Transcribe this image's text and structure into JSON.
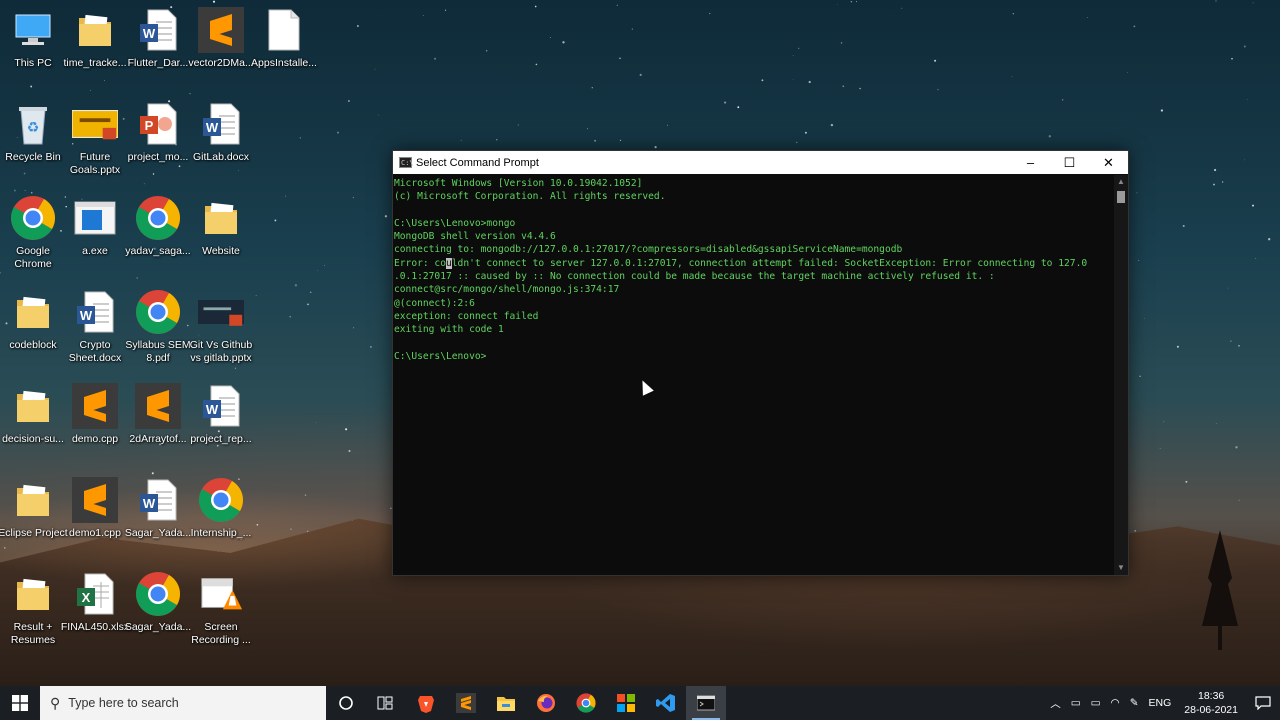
{
  "desktop_icons": [
    {
      "label": "This PC",
      "icon": "this-pc-icon"
    },
    {
      "label": "time_tracke...",
      "icon": "folder-icon"
    },
    {
      "label": "Flutter_Dar...",
      "icon": "word-doc-icon"
    },
    {
      "label": "vector2DMa...",
      "icon": "sublime-icon"
    },
    {
      "label": "AppsInstalle...",
      "icon": "text-file-icon"
    },
    {
      "label": "Recycle Bin",
      "icon": "recycle-bin-icon"
    },
    {
      "label": "Future Goals.pptx",
      "icon": "pptx-thumb-icon"
    },
    {
      "label": "project_mo...",
      "icon": "powerpoint-icon"
    },
    {
      "label": "GitLab.docx",
      "icon": "word-doc-icon"
    },
    {
      "label": "Google Chrome",
      "icon": "chrome-icon"
    },
    {
      "label": "a.exe",
      "icon": "exe-icon"
    },
    {
      "label": "yadav_saga...",
      "icon": "chrome-icon"
    },
    {
      "label": "Website",
      "icon": "folder-icon"
    },
    {
      "label": "codeblock",
      "icon": "folder-icon"
    },
    {
      "label": "Crypto Sheet.docx",
      "icon": "word-doc-icon"
    },
    {
      "label": "Syllabus SEM 8.pdf",
      "icon": "chrome-icon"
    },
    {
      "label": "Git Vs Github vs gitlab.pptx",
      "icon": "pptx-dark-thumb-icon"
    },
    {
      "label": "decision-su...",
      "icon": "folder-icon"
    },
    {
      "label": "demo.cpp",
      "icon": "sublime-icon"
    },
    {
      "label": "2dArraytof...",
      "icon": "sublime-icon"
    },
    {
      "label": "project_rep...",
      "icon": "word-doc-icon"
    },
    {
      "label": "Eclipse Project",
      "icon": "folder-icon"
    },
    {
      "label": "demo1.cpp",
      "icon": "sublime-icon"
    },
    {
      "label": "Sagar_Yada...",
      "icon": "word-doc-icon"
    },
    {
      "label": "Internship_...",
      "icon": "chrome-icon"
    },
    {
      "label": "Result + Resumes",
      "icon": "folder-icon"
    },
    {
      "label": "FINAL450.xlsx",
      "icon": "excel-icon"
    },
    {
      "label": "Sagar_Yada...",
      "icon": "chrome-icon"
    },
    {
      "label": "Screen Recording ...",
      "icon": "video-file-icon"
    }
  ],
  "cmd_window": {
    "title": "Select Command Prompt",
    "lines": [
      "Microsoft Windows [Version 10.0.19042.1052]",
      "(c) Microsoft Corporation. All rights reserved.",
      "",
      "C:\\Users\\Lenovo>mongo",
      "MongoDB shell version v4.4.6",
      "connecting to: mongodb://127.0.0.1:27017/?compressors=disabled&gssapiServiceName=mongodb",
      "Error: couldn't connect to server 127.0.0.1:27017, connection attempt failed: SocketException: Error connecting to 127.0",
      ".0.1:27017 :: caused by :: No connection could be made because the target machine actively refused it. :",
      "connect@src/mongo/shell/mongo.js:374:17",
      "@(connect):2:6",
      "exception: connect failed",
      "exiting with code 1",
      "",
      "C:\\Users\\Lenovo>"
    ],
    "minimize": "–",
    "maximize": "☐",
    "close": "✕"
  },
  "taskbar": {
    "search_placeholder": "Type here to search",
    "apps": [
      "cortana-icon",
      "task-view-icon",
      "brave-icon",
      "sublime-icon",
      "file-explorer-icon",
      "firefox-icon",
      "chrome-icon",
      "store-icon",
      "vscode-icon",
      "cmd-icon"
    ],
    "language": "ENG",
    "time": "18:36",
    "date": "28-06-2021"
  }
}
